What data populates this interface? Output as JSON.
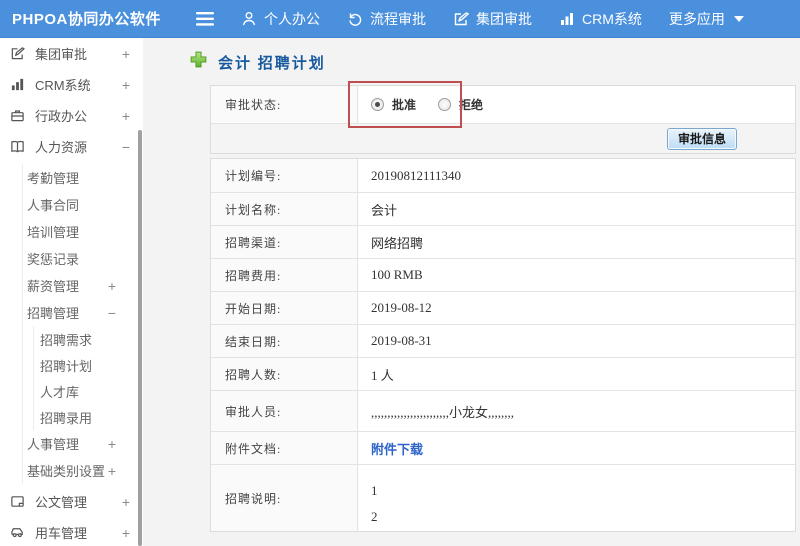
{
  "colors": {
    "header_bg": "#4a90dd",
    "title_blue": "#17599e",
    "link_blue": "#2e64c8",
    "annotation_red": "#bf4e4e",
    "plus_green": "#6fbe3a"
  },
  "header": {
    "logo": "PHPOA协同办公软件",
    "nav": [
      {
        "label": "个人办公"
      },
      {
        "label": "流程审批"
      },
      {
        "label": "集团审批"
      },
      {
        "label": "CRM系统"
      },
      {
        "label": "更多应用"
      }
    ]
  },
  "sidebar": {
    "items": [
      {
        "label": "集团审批",
        "toggle": "+"
      },
      {
        "label": "CRM系统",
        "toggle": "+"
      },
      {
        "label": "行政办公",
        "toggle": "+"
      },
      {
        "label": "人力资源",
        "toggle": "−"
      },
      {
        "label": "考勤管理"
      },
      {
        "label": "人事合同"
      },
      {
        "label": "培训管理"
      },
      {
        "label": "奖惩记录"
      },
      {
        "label": "薪资管理",
        "toggle": "+"
      },
      {
        "label": "招聘管理",
        "toggle": "−"
      },
      {
        "label": "招聘需求"
      },
      {
        "label": "招聘计划"
      },
      {
        "label": "人才库"
      },
      {
        "label": "招聘录用"
      },
      {
        "label": "人事管理",
        "toggle": "+"
      },
      {
        "label": "基础类别设置",
        "toggle": "+"
      },
      {
        "label": "公文管理",
        "toggle": "+"
      },
      {
        "label": "用车管理",
        "toggle": "+"
      }
    ]
  },
  "main": {
    "page_title": "会计 招聘计划",
    "approval_status": {
      "label": "审批状态:",
      "options": [
        {
          "label": "批准",
          "selected": true
        },
        {
          "label": "拒绝",
          "selected": false
        }
      ]
    },
    "approval_info_button": "审批信息",
    "fields": [
      {
        "label": "计划编号:",
        "value": "20190812111340"
      },
      {
        "label": "计划名称:",
        "value": "会计"
      },
      {
        "label": "招聘渠道:",
        "value": "网络招聘"
      },
      {
        "label": "招聘费用:",
        "value": "100 RMB"
      },
      {
        "label": "开始日期:",
        "value": "2019-08-12"
      },
      {
        "label": "结束日期:",
        "value": "2019-08-31"
      },
      {
        "label": "招聘人数:",
        "value": "1 人"
      },
      {
        "label": "审批人员:",
        "value": ",,,,,,,,,,,,,,,,,,,,,,,,小龙女,,,,,,,,"
      },
      {
        "label": "附件文档:",
        "value": "附件下载"
      },
      {
        "label": "招聘说明:",
        "value": "1\n2"
      }
    ]
  }
}
